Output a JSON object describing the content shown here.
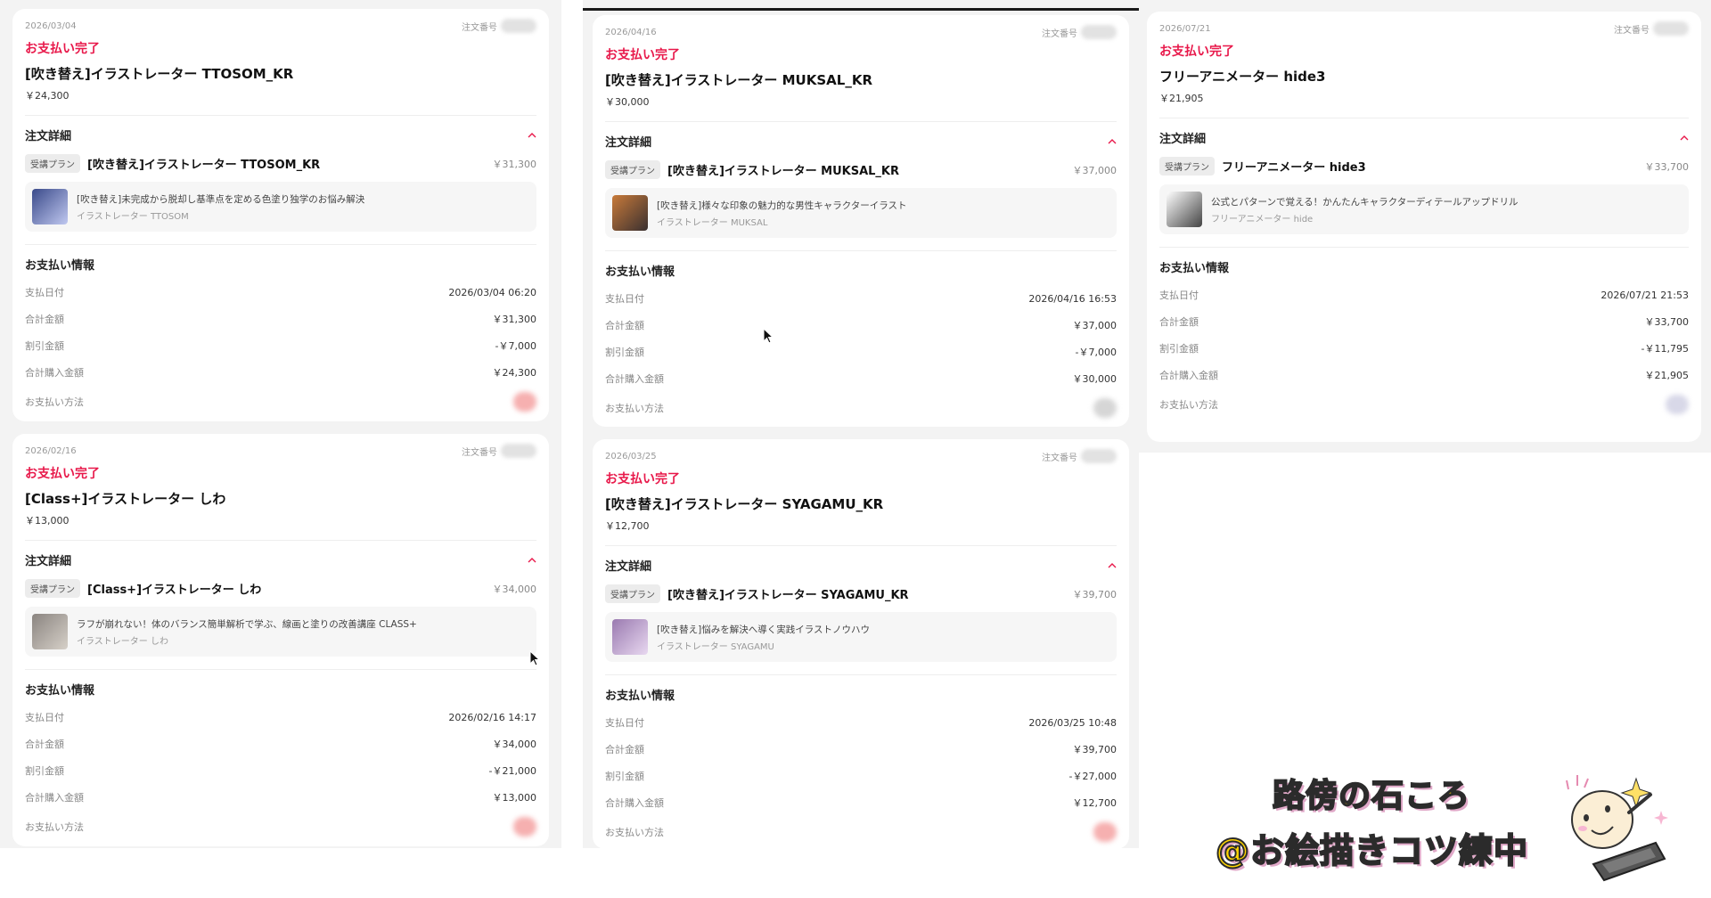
{
  "labels": {
    "order_number": "注文番号",
    "order_details": "注文詳細",
    "plan_badge": "受講プラン",
    "payment_info": "お支払い情報",
    "payment_date": "支払日付",
    "total_amount": "合計金額",
    "discount_amount": "割引金額",
    "total_purchase": "合計購入金額",
    "payment_method": "お支払い方法"
  },
  "orders": [
    {
      "date": "2026/03/04",
      "status": "お支払い完了",
      "title": "[吹き替え]イラストレーター TTOSOM_KR",
      "price": "￥24,300",
      "plan_name": "[吹き替え]イラストレーター TTOSOM_KR",
      "plan_price": "￥31,300",
      "course_title": "[吹き替え]未完成から脱却し基準点を定める色塗り独学のお悩み解決",
      "course_author": "イラストレーター TTOSOM",
      "pay_date": "2026/03/04 06:20",
      "total": "￥31,300",
      "discount": "-￥7,000",
      "purchase_total": "￥24,300",
      "method_color": "#f6b0b0",
      "thumb_colors": [
        "#3a4a8a",
        "#c0c8f0"
      ]
    },
    {
      "date": "2026/02/16",
      "status": "お支払い完了",
      "title": "[Class+]イラストレーター しわ",
      "price": "￥13,000",
      "plan_name": "[Class+]イラストレーター しわ",
      "plan_price": "￥34,000",
      "course_title": "ラフが崩れない！体のバランス簡単解析で学ぶ、線画と塗りの改善講座 CLASS+",
      "course_author": "イラストレーター しわ",
      "pay_date": "2026/02/16 14:17",
      "total": "￥34,000",
      "discount": "-￥21,000",
      "purchase_total": "￥13,000",
      "method_color": "#f6b0b0",
      "thumb_colors": [
        "#8a8480",
        "#d6d0c8"
      ]
    },
    {
      "date": "2026/04/16",
      "status": "お支払い完了",
      "title": "[吹き替え]イラストレーター MUKSAL_KR",
      "price": "￥30,000",
      "plan_name": "[吹き替え]イラストレーター MUKSAL_KR",
      "plan_price": "￥37,000",
      "course_title": "[吹き替え]様々な印象の魅力的な男性キャラクターイラスト",
      "course_author": "イラストレーター MUKSAL",
      "pay_date": "2026/04/16 16:53",
      "total": "￥37,000",
      "discount": "-￥7,000",
      "purchase_total": "￥30,000",
      "method_color": "#d6d6d6",
      "thumb_colors": [
        "#c87a3a",
        "#3a3030"
      ]
    },
    {
      "date": "2026/03/25",
      "status": "お支払い完了",
      "title": "[吹き替え]イラストレーター SYAGAMU_KR",
      "price": "￥12,700",
      "plan_name": "[吹き替え]イラストレーター SYAGAMU_KR",
      "plan_price": "￥39,700",
      "course_title": "[吹き替え]悩みを解決へ導く実践イラストノウハウ",
      "course_author": "イラストレーター SYAGAMU",
      "pay_date": "2026/03/25 10:48",
      "total": "￥39,700",
      "discount": "-￥27,000",
      "purchase_total": "￥12,700",
      "method_color": "#f6b0b0",
      "thumb_colors": [
        "#9a7ab0",
        "#e8d8f0"
      ]
    },
    {
      "date": "2026/07/21",
      "status": "お支払い完了",
      "title": "フリーアニメーター hide3",
      "price": "￥21,905",
      "plan_name": "フリーアニメーター hide3",
      "plan_price": "￥33,700",
      "course_title": "公式とパターンで覚える！かんたんキャラクターディテールアップドリル",
      "course_author": "フリーアニメーター hide",
      "pay_date": "2026/07/21 21:53",
      "total": "￥33,700",
      "discount": "-￥11,795",
      "purchase_total": "￥21,905",
      "method_color": "#d8d8e8",
      "thumb_colors": [
        "#ffffff",
        "#444444"
      ]
    }
  ],
  "watermark": {
    "line1": "路傍の石ころ",
    "line2": "@お絵描きコツ練中"
  }
}
